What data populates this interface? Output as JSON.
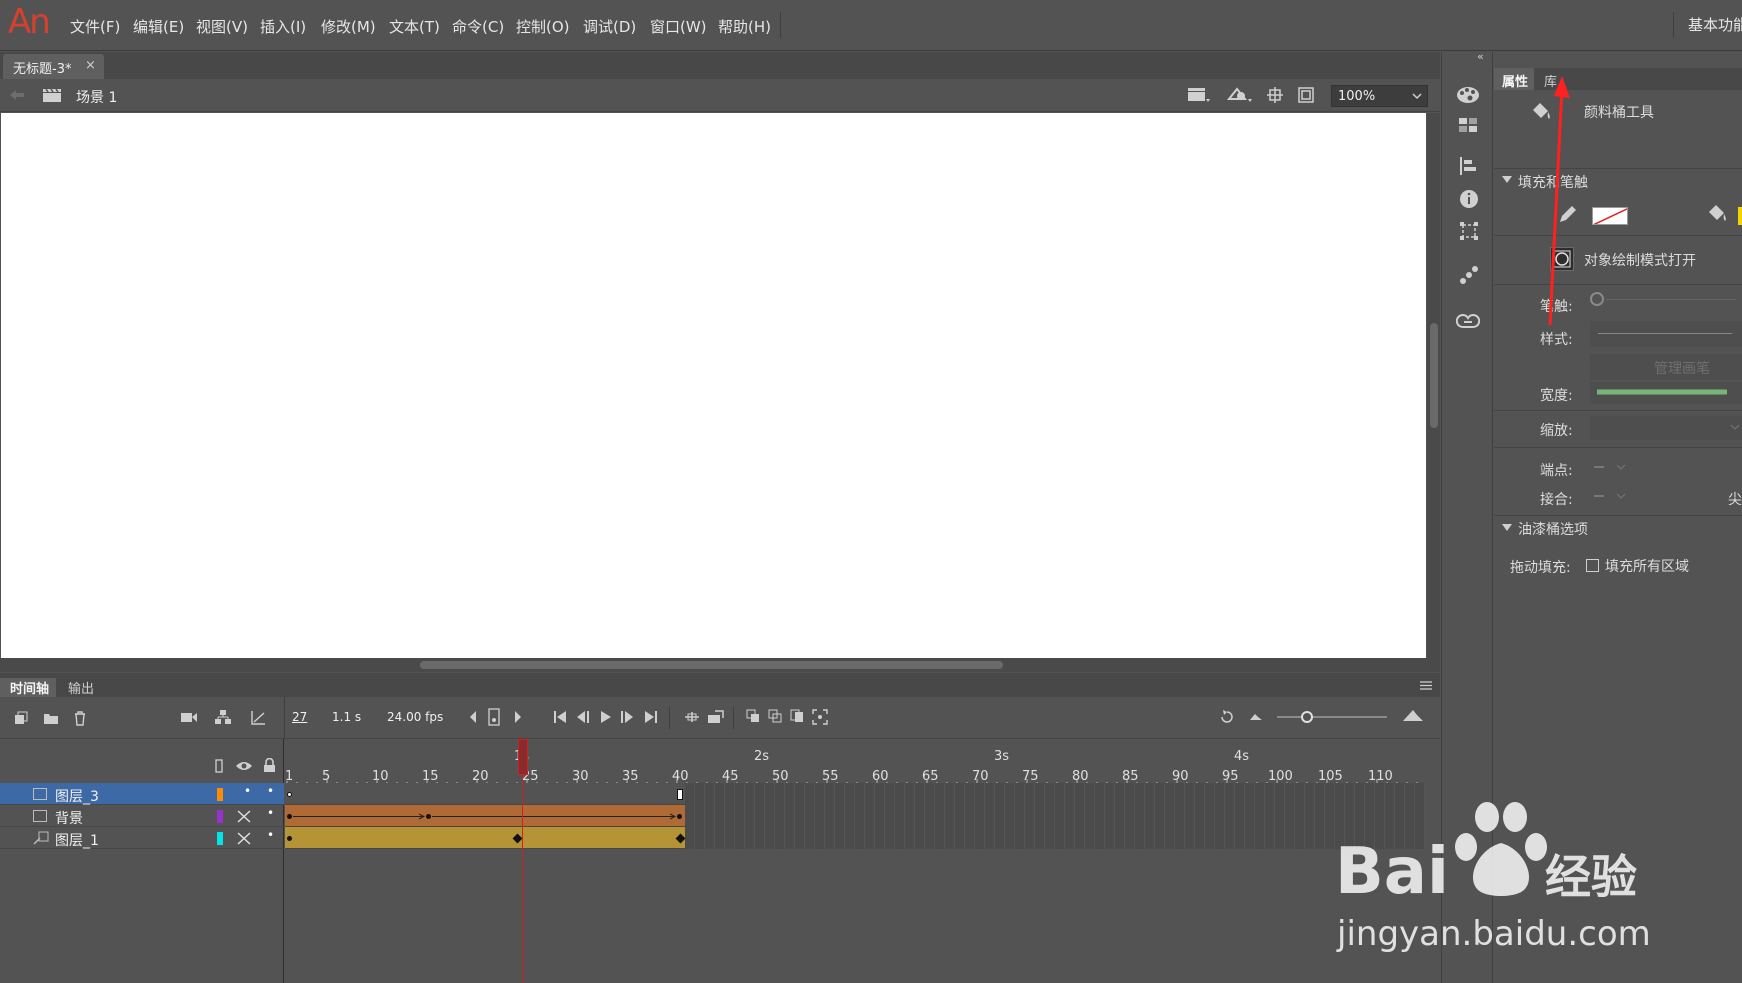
{
  "app": {
    "logo": "An",
    "workspace": "基本功能"
  },
  "menu": [
    "文件(F)",
    "编辑(E)",
    "视图(V)",
    "插入(I)",
    "修改(M)",
    "文本(T)",
    "命令(C)",
    "控制(O)",
    "调试(D)",
    "窗口(W)",
    "帮助(H)"
  ],
  "document": {
    "tab_title": "无标题-3*",
    "close_glyph": "×",
    "scene": "场景 1",
    "zoom": "100%"
  },
  "timeline": {
    "tabs": [
      "时间轴",
      "输出"
    ],
    "current_frame": "27",
    "elapsed": "1.1 s",
    "fps": "24.00 fps",
    "seconds_labels": [
      "1s",
      "2s",
      "3s",
      "4s"
    ],
    "frame_labels": [
      "1",
      "5",
      "10",
      "15",
      "20",
      "25",
      "30",
      "35",
      "40",
      "45",
      "50",
      "55",
      "60",
      "65",
      "70",
      "75",
      "80",
      "85",
      "90",
      "95",
      "100",
      "105",
      "110"
    ],
    "layers": [
      {
        "name": "图层_3",
        "color": "#ff8c00",
        "selected": true
      },
      {
        "name": "背景",
        "color": "#9b30d0",
        "selected": false
      },
      {
        "name": "图层_1",
        "color": "#00e5e5",
        "selected": false
      }
    ]
  },
  "properties": {
    "tabs": [
      "属性",
      "库"
    ],
    "tool_name": "颜料桶工具",
    "section_fill_stroke": "填充和笔触",
    "object_draw_mode": "对象绘制模式打开",
    "stroke_label": "笔触:",
    "style_label": "样式:",
    "manage_brush": "管理画笔",
    "width_label": "宽度:",
    "scale_label": "缩放:",
    "cap_label": "端点:",
    "join_label": "接合:",
    "sharp_label": "尖",
    "section_bucket": "油漆桶选项",
    "drag_fill_label": "拖动填充:",
    "fill_all_label": "填充所有区域"
  },
  "colors": {
    "accent": "#3d6aa6",
    "logo": "#d7402f",
    "tween_orange": "#b06a35",
    "tween_gold": "#b59436",
    "playhead": "#cc2222"
  },
  "watermark": {
    "brand": "Bai 经验",
    "url": "jingyan.baidu.com"
  }
}
